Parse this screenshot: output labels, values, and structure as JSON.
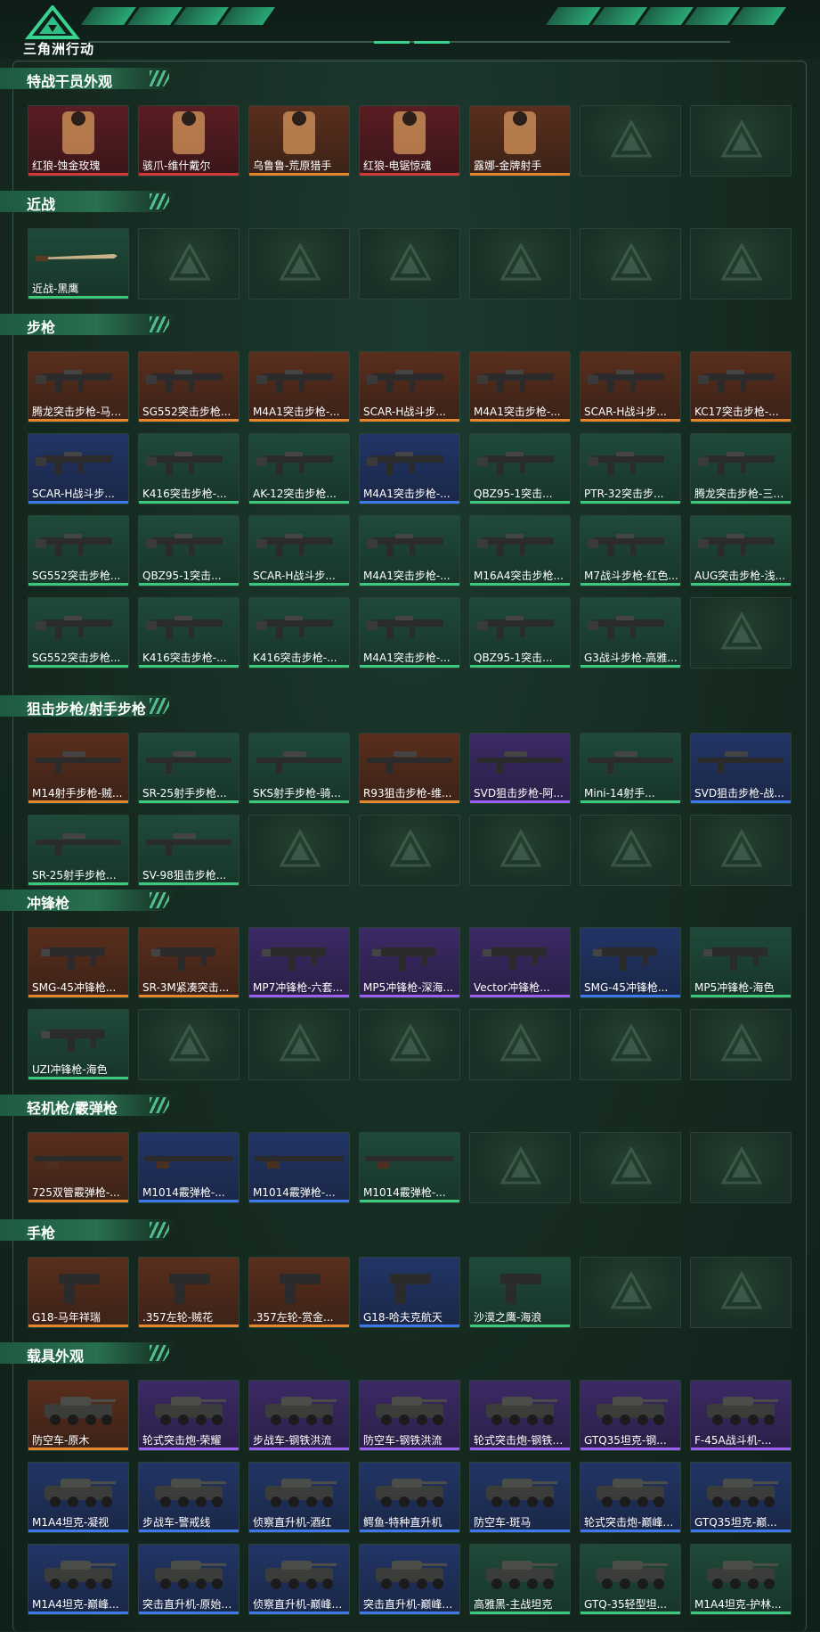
{
  "app": {
    "logo_text": "三角洲行动",
    "colors": {
      "accent": "#39d38f",
      "orange": "#e4862b",
      "red": "#d23a3a",
      "blue": "#3f78e8",
      "purple": "#9a5ef0",
      "green": "#3ec77f"
    }
  },
  "sections": [
    {
      "title": "特战干员外观",
      "items": [
        {
          "label": "红狼-蚀金玫瑰",
          "rarity": "red",
          "icon": "operator-icon"
        },
        {
          "label": "骇爪-维什戴尔",
          "rarity": "red",
          "icon": "operator-icon"
        },
        {
          "label": "乌鲁鲁-荒原猎手",
          "rarity": "orange",
          "icon": "operator-icon"
        },
        {
          "label": "红狼-电锯惊魂",
          "rarity": "red",
          "icon": "operator-icon"
        },
        {
          "label": "露娜-金牌射手",
          "rarity": "orange",
          "icon": "operator-icon"
        },
        null,
        null
      ]
    },
    {
      "title": "近战",
      "items": [
        {
          "label": "近战-黑鹰",
          "rarity": "green",
          "icon": "knife-icon"
        },
        null,
        null,
        null,
        null,
        null,
        null
      ]
    },
    {
      "title": "步枪",
      "items": [
        {
          "label": "腾龙突击步枪-马年...",
          "rarity": "orange",
          "icon": "rifle-icon"
        },
        {
          "label": "SG552突击步枪...",
          "rarity": "orange",
          "icon": "rifle-icon"
        },
        {
          "label": "M4A1突击步枪-...",
          "rarity": "orange",
          "icon": "rifle-icon"
        },
        {
          "label": "SCAR-H战斗步...",
          "rarity": "orange",
          "icon": "rifle-icon"
        },
        {
          "label": "M4A1突击步枪-...",
          "rarity": "orange",
          "icon": "rifle-icon"
        },
        {
          "label": "SCAR-H战斗步...",
          "rarity": "orange",
          "icon": "rifle-icon"
        },
        {
          "label": "KC17突击步枪-...",
          "rarity": "orange",
          "icon": "rifle-icon"
        },
        {
          "label": "SCAR-H战斗步...",
          "rarity": "blue",
          "icon": "rifle-icon"
        },
        {
          "label": "K416突击步枪-...",
          "rarity": "green",
          "icon": "rifle-icon"
        },
        {
          "label": "AK-12突击步枪...",
          "rarity": "green",
          "icon": "rifle-icon"
        },
        {
          "label": "M4A1突击步枪-...",
          "rarity": "blue",
          "icon": "rifle-icon"
        },
        {
          "label": "QBZ95-1突击...",
          "rarity": "green",
          "icon": "rifle-icon"
        },
        {
          "label": "PTR-32突击步...",
          "rarity": "green",
          "icon": "rifle-icon"
        },
        {
          "label": "腾龙突击步枪-三角...",
          "rarity": "green",
          "icon": "rifle-icon"
        },
        {
          "label": "SG552突击步枪...",
          "rarity": "green",
          "icon": "rifle-icon"
        },
        {
          "label": "QBZ95-1突击...",
          "rarity": "green",
          "icon": "rifle-icon"
        },
        {
          "label": "SCAR-H战斗步...",
          "rarity": "green",
          "icon": "rifle-icon"
        },
        {
          "label": "M4A1突击步枪-...",
          "rarity": "green",
          "icon": "rifle-icon"
        },
        {
          "label": "M16A4突击步枪...",
          "rarity": "green",
          "icon": "rifle-icon"
        },
        {
          "label": "M7战斗步枪-红色...",
          "rarity": "green",
          "icon": "rifle-icon"
        },
        {
          "label": "AUG突击步枪-浅...",
          "rarity": "green",
          "icon": "rifle-icon"
        },
        {
          "label": "SG552突击步枪...",
          "rarity": "green",
          "icon": "rifle-icon"
        },
        {
          "label": "K416突击步枪-...",
          "rarity": "green",
          "icon": "rifle-icon"
        },
        {
          "label": "K416突击步枪-...",
          "rarity": "green",
          "icon": "rifle-icon"
        },
        {
          "label": "M4A1突击步枪-...",
          "rarity": "green",
          "icon": "rifle-icon"
        },
        {
          "label": "QBZ95-1突击...",
          "rarity": "green",
          "icon": "rifle-icon"
        },
        {
          "label": "G3战斗步枪-高雅...",
          "rarity": "green",
          "icon": "rifle-icon"
        },
        null
      ]
    },
    {
      "title": "狙击步枪/射手步枪",
      "items": [
        {
          "label": "M14射手步枪-贼...",
          "rarity": "orange",
          "icon": "sniper-icon"
        },
        {
          "label": "SR-25射手步枪...",
          "rarity": "green",
          "icon": "sniper-icon"
        },
        {
          "label": "SKS射手步枪-骑...",
          "rarity": "green",
          "icon": "sniper-icon"
        },
        {
          "label": "R93狙击步枪-维...",
          "rarity": "orange",
          "icon": "sniper-icon"
        },
        {
          "label": "SVD狙击步枪-阿...",
          "rarity": "purple",
          "icon": "sniper-icon"
        },
        {
          "label": "Mini-14射手...",
          "rarity": "green",
          "icon": "sniper-icon"
        },
        {
          "label": "SVD狙击步枪-战...",
          "rarity": "blue",
          "icon": "sniper-icon"
        },
        {
          "label": "SR-25射手步枪...",
          "rarity": "green",
          "icon": "sniper-icon"
        },
        {
          "label": "SV-98狙击步枪...",
          "rarity": "green",
          "icon": "sniper-icon"
        },
        null,
        null,
        null,
        null,
        null
      ]
    },
    {
      "title": "冲锋枪",
      "items": [
        {
          "label": "SMG-45冲锋枪...",
          "rarity": "orange",
          "icon": "smg-icon"
        },
        {
          "label": "SR-3M紧凑突击...",
          "rarity": "orange",
          "icon": "smg-icon"
        },
        {
          "label": "MP7冲锋枪-六套...",
          "rarity": "purple",
          "icon": "smg-icon"
        },
        {
          "label": "MP5冲锋枪-深海...",
          "rarity": "purple",
          "icon": "smg-icon"
        },
        {
          "label": "Vector冲锋枪...",
          "rarity": "purple",
          "icon": "smg-icon"
        },
        {
          "label": "SMG-45冲锋枪...",
          "rarity": "blue",
          "icon": "smg-icon"
        },
        {
          "label": "MP5冲锋枪-海色",
          "rarity": "green",
          "icon": "smg-icon"
        },
        {
          "label": "UZI冲锋枪-海色",
          "rarity": "green",
          "icon": "smg-icon"
        },
        null,
        null,
        null,
        null,
        null,
        null
      ]
    },
    {
      "title": "轻机枪/霰弹枪",
      "items": [
        {
          "label": "725双管霰弹枪-...",
          "rarity": "orange",
          "icon": "shotgun-icon"
        },
        {
          "label": "M1014霰弹枪-...",
          "rarity": "blue",
          "icon": "shotgun-icon"
        },
        {
          "label": "M1014霰弹枪-...",
          "rarity": "blue",
          "icon": "shotgun-icon"
        },
        {
          "label": "M1014霰弹枪-...",
          "rarity": "green",
          "icon": "shotgun-icon"
        },
        null,
        null,
        null
      ]
    },
    {
      "title": "手枪",
      "items": [
        {
          "label": "G18-马年祥瑞",
          "rarity": "orange",
          "icon": "pistol-icon"
        },
        {
          "label": ".357左轮-贼花",
          "rarity": "orange",
          "icon": "pistol-icon"
        },
        {
          "label": ".357左轮-赏金...",
          "rarity": "orange",
          "icon": "pistol-icon"
        },
        {
          "label": "G18-哈夫克航天",
          "rarity": "blue",
          "icon": "pistol-icon"
        },
        {
          "label": "沙漠之鹰-海浪",
          "rarity": "green",
          "icon": "pistol-icon"
        },
        null,
        null
      ]
    },
    {
      "title": "载具外观",
      "items": [
        {
          "label": "防空车-原木",
          "rarity": "orange",
          "icon": "vehicle-icon"
        },
        {
          "label": "轮式突击炮-荣耀",
          "rarity": "purple",
          "icon": "vehicle-icon"
        },
        {
          "label": "步战车-钢铁洪流",
          "rarity": "purple",
          "icon": "vehicle-icon"
        },
        {
          "label": "防空车-钢铁洪流",
          "rarity": "purple",
          "icon": "vehicle-icon"
        },
        {
          "label": "轮式突击炮-钢铁洪...",
          "rarity": "purple",
          "icon": "vehicle-icon"
        },
        {
          "label": "GTQ35坦克-钢...",
          "rarity": "purple",
          "icon": "vehicle-icon"
        },
        {
          "label": "F-45A战斗机-...",
          "rarity": "purple",
          "icon": "vehicle-icon"
        },
        {
          "label": "M1A4坦克-凝视",
          "rarity": "blue",
          "icon": "vehicle-icon"
        },
        {
          "label": "步战车-警戒线",
          "rarity": "blue",
          "icon": "vehicle-icon"
        },
        {
          "label": "侦察直升机-酒红",
          "rarity": "blue",
          "icon": "vehicle-icon"
        },
        {
          "label": "鳄鱼-特种直升机",
          "rarity": "blue",
          "icon": "vehicle-icon"
        },
        {
          "label": "防空车-斑马",
          "rarity": "blue",
          "icon": "vehicle-icon"
        },
        {
          "label": "轮式突击炮-巅峰竞...",
          "rarity": "blue",
          "icon": "vehicle-icon"
        },
        {
          "label": "GTQ35坦克-巅...",
          "rarity": "blue",
          "icon": "vehicle-icon"
        },
        {
          "label": "M1A4坦克-巅峰...",
          "rarity": "blue",
          "icon": "vehicle-icon"
        },
        {
          "label": "突击直升机-原始伪...",
          "rarity": "blue",
          "icon": "vehicle-icon"
        },
        {
          "label": "侦察直升机-巅峰竞...",
          "rarity": "blue",
          "icon": "vehicle-icon"
        },
        {
          "label": "突击直升机-巅峰竞...",
          "rarity": "blue",
          "icon": "vehicle-icon"
        },
        {
          "label": "高雅黑-主战坦克",
          "rarity": "green",
          "icon": "vehicle-icon"
        },
        {
          "label": "GTQ-35轻型坦...",
          "rarity": "green",
          "icon": "vehicle-icon"
        },
        {
          "label": "M1A4坦克-护林...",
          "rarity": "green",
          "icon": "vehicle-icon"
        }
      ]
    }
  ]
}
